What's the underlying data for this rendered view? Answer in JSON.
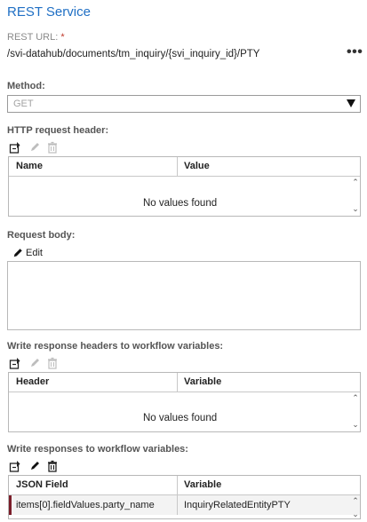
{
  "header": {
    "title": "REST Service"
  },
  "rest_url": {
    "label": "REST URL:",
    "required_mark": "*",
    "value": "/svi-datahub/documents/tm_inquiry/{svi_inquiry_id}/PTY",
    "more": "•••"
  },
  "method": {
    "label": "Method:",
    "value": "GET"
  },
  "http_header": {
    "label": "HTTP request header:",
    "columns": [
      "Name",
      "Value"
    ],
    "empty_text": "No values found"
  },
  "request_body": {
    "label": "Request body:",
    "edit_label": "Edit"
  },
  "response_headers": {
    "label": "Write response headers to workflow variables:",
    "columns": [
      "Header",
      "Variable"
    ],
    "empty_text": "No values found"
  },
  "responses": {
    "label": "Write responses to workflow variables:",
    "columns": [
      "JSON Field",
      "Variable"
    ],
    "rows": [
      {
        "json_field": "items[0].fieldValues.party_name",
        "variable": "InquiryRelatedEntityPTY"
      }
    ]
  },
  "colors": {
    "title": "#1f6fc4",
    "required": "#c0392b",
    "row_marker": "#7b1e2a"
  },
  "icons": [
    "add-icon",
    "edit-pencil-icon",
    "delete-trash-icon",
    "scroll-up-icon",
    "scroll-down-icon",
    "dropdown-arrow-icon"
  ]
}
